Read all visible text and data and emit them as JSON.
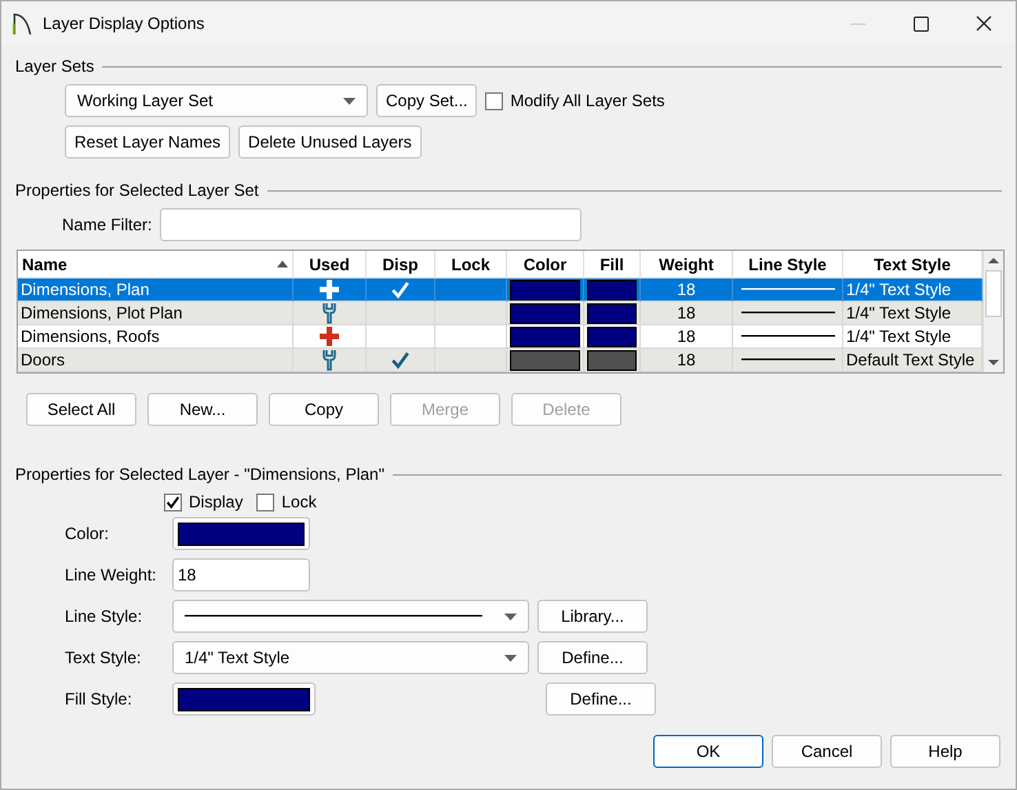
{
  "window": {
    "title": "Layer Display Options"
  },
  "layer_sets": {
    "title": "Layer Sets",
    "set_dropdown": {
      "value": "Working Layer Set"
    },
    "copy_button": "Copy Set...",
    "modify_all": {
      "label": "Modify All Layer Sets",
      "checked": false
    },
    "buttons": [
      "Reset Layer Names",
      "Delete Unused Layers"
    ]
  },
  "set_properties": {
    "title": "Properties for Selected Layer Set",
    "name_filter": {
      "label": "Name Filter:"
    },
    "table": {
      "columns": [
        "Name",
        "Used",
        "Disp",
        "Lock",
        "Color",
        "Fill",
        "Weight",
        "Line Style",
        "Text Style"
      ],
      "rows": [
        {
          "name": "Dimensions, Plan",
          "selected": true,
          "used": {
            "kind": "plus"
          },
          "disp": true,
          "lock": false,
          "color": "#000080",
          "fill": {
            "color": "#000080"
          },
          "weight": "18",
          "text_style": "1/4\" Text Style"
        },
        {
          "name": "Dimensions, Plot Plan",
          "selected": false,
          "used": {
            "kind": "wrench"
          },
          "disp": false,
          "lock": false,
          "color": "#000080",
          "fill": {
            "color": "#000080"
          },
          "weight": "18",
          "text_style": "1/4\" Text Style"
        },
        {
          "name": "Dimensions, Roofs",
          "selected": false,
          "used": {
            "kind": "plus"
          },
          "disp": false,
          "lock": false,
          "color": "#000080",
          "fill": {
            "color": "#000080"
          },
          "weight": "18",
          "text_style": "1/4\" Text Style"
        },
        {
          "name": "Doors",
          "selected": false,
          "used": {
            "kind": "wrench"
          },
          "disp": true,
          "lock": false,
          "color": "#505050",
          "fill": {
            "color": "#505050"
          },
          "weight": "18",
          "text_style": "Default Text Style"
        }
      ]
    },
    "buttons": [
      {
        "label": "Select All",
        "disabled": false
      },
      {
        "label": "New...",
        "disabled": false
      },
      {
        "label": "Copy",
        "disabled": false
      },
      {
        "label": "Merge",
        "disabled": true
      },
      {
        "label": "Delete",
        "disabled": true
      }
    ]
  },
  "layer_properties": {
    "title": "Properties for Selected Layer - \"Dimensions, Plan\"",
    "display": {
      "label": "Display",
      "checked": true
    },
    "lock": {
      "label": "Lock",
      "checked": false
    },
    "color": {
      "label": "Color:",
      "color": "#000080"
    },
    "line_weight": {
      "label": "Line Weight:",
      "value": "18"
    },
    "line_style": {
      "label": "Line Style:",
      "button": "Library..."
    },
    "text_style": {
      "label": "Text Style:",
      "value": "1/4\" Text Style",
      "button": "Define..."
    },
    "fill_style": {
      "label": "Fill Style:",
      "color": "#000080",
      "button": "Define..."
    }
  },
  "footer": [
    {
      "label": "OK",
      "default": true
    },
    {
      "label": "Cancel",
      "default": false
    },
    {
      "label": "Help",
      "default": false
    }
  ]
}
